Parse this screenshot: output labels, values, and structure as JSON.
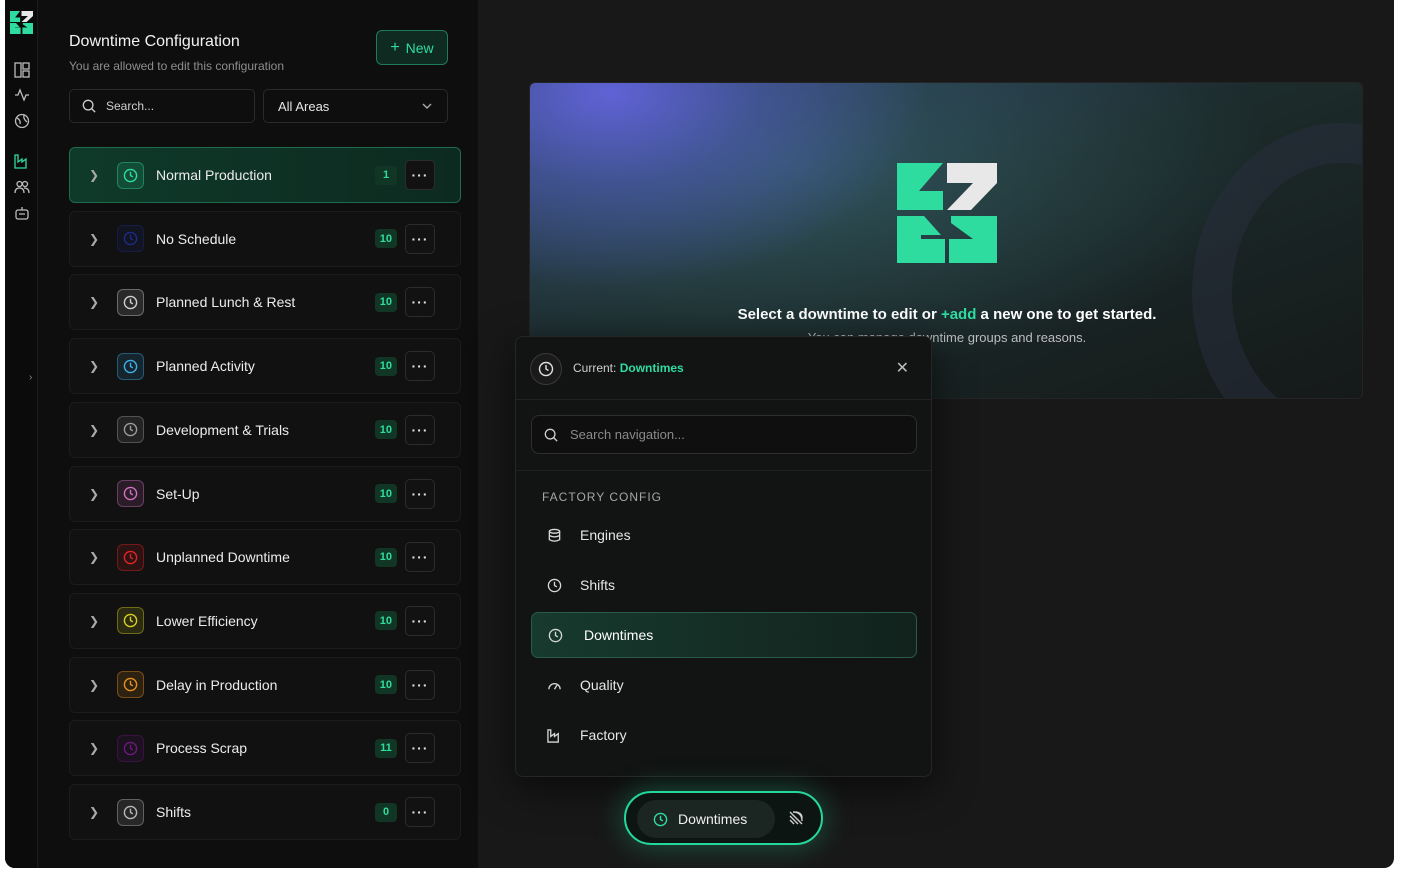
{
  "panel": {
    "title": "Downtime Configuration",
    "subtitle": "You are allowed to edit this configuration",
    "new_label": "New",
    "search_placeholder": "Search...",
    "area_select": "All Areas"
  },
  "rows": [
    {
      "label": "Normal Production",
      "count": "1",
      "color": "#2fdca0",
      "active": true
    },
    {
      "label": "No Schedule",
      "count": "10",
      "color": "#1d2a8a"
    },
    {
      "label": "Planned Lunch & Rest",
      "count": "10",
      "color": "#d0d0d0"
    },
    {
      "label": "Planned Activity",
      "count": "10",
      "color": "#3bb0e8"
    },
    {
      "label": "Development & Trials",
      "count": "10",
      "color": "#9a9a9a"
    },
    {
      "label": "Set-Up",
      "count": "10",
      "color": "#d070c0"
    },
    {
      "label": "Unplanned Downtime",
      "count": "10",
      "color": "#e02424"
    },
    {
      "label": "Lower Efficiency",
      "count": "10",
      "color": "#d8d020"
    },
    {
      "label": "Delay in Production",
      "count": "10",
      "color": "#e8901c"
    },
    {
      "label": "Process Scrap",
      "count": "11",
      "color": "#6a1a7a"
    },
    {
      "label": "Shifts",
      "count": "0",
      "color": "#b8b8b8"
    }
  ],
  "hero": {
    "title_pre": "Select a downtime to edit or ",
    "title_add": "+add",
    "title_post": " a new one to get started.",
    "subtitle": "You can manage downtime groups and reasons."
  },
  "nav": {
    "current_label": "Current:",
    "current_value": "Downtimes",
    "search_placeholder": "Search navigation...",
    "section": "FACTORY CONFIG",
    "items": [
      {
        "label": "Engines",
        "icon": "database-icon"
      },
      {
        "label": "Shifts",
        "icon": "clock-icon"
      },
      {
        "label": "Downtimes",
        "icon": "clock-icon",
        "active": true
      },
      {
        "label": "Quality",
        "icon": "gauge-icon"
      },
      {
        "label": "Factory",
        "icon": "factory-icon"
      }
    ]
  },
  "floating_bar": {
    "label": "Downtimes"
  },
  "colors": {
    "accent": "#2fdca0",
    "background": "#181818"
  }
}
